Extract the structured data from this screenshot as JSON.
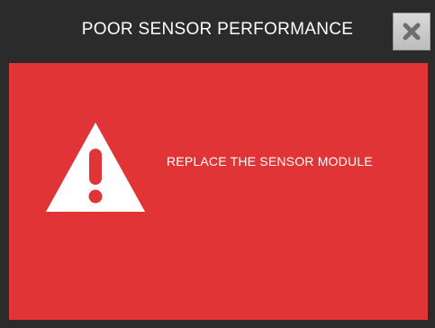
{
  "dialog": {
    "title": "POOR SENSOR PERFORMANCE",
    "close_icon": "close-x-icon",
    "warning_icon": "warning-triangle-icon",
    "message": "REPLACE THE SENSOR MODULE"
  },
  "colors": {
    "frame": "#2b2b2b",
    "alert_background": "#e03436",
    "text": "#ffffff",
    "close_button": "#cccccc"
  }
}
